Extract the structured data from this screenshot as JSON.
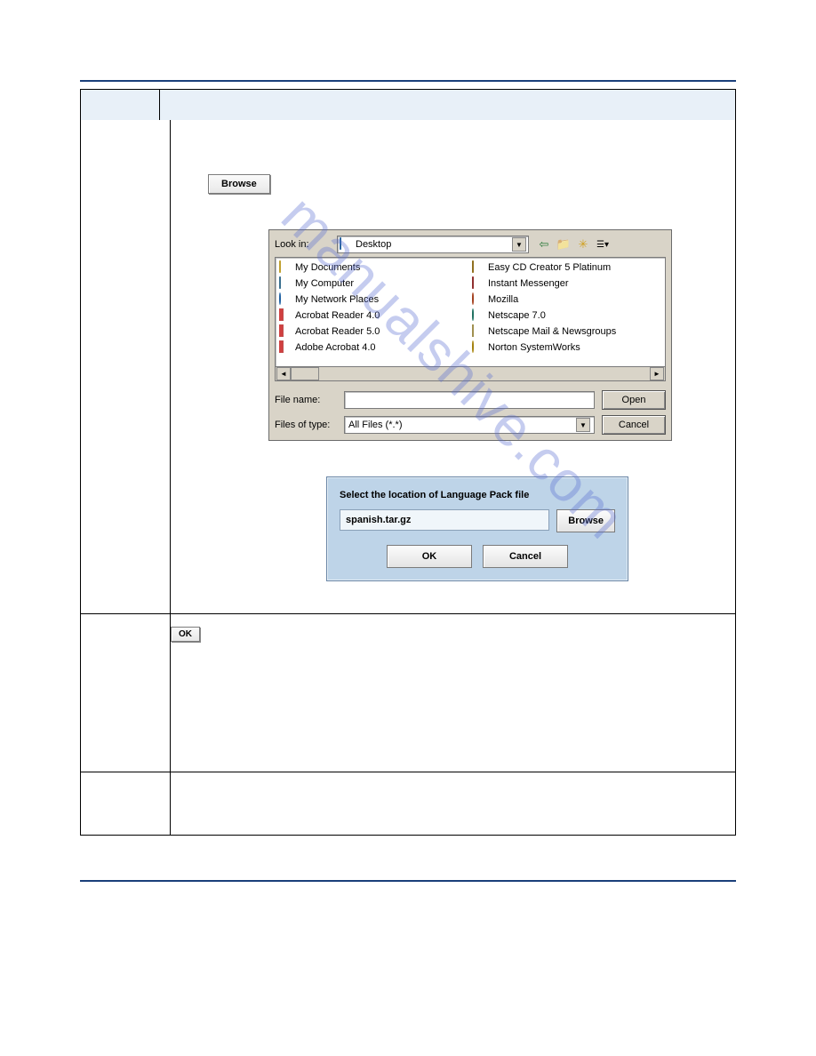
{
  "watermark": "manualshive.com",
  "buttons": {
    "browse_large": "Browse",
    "ok_small": "OK"
  },
  "file_dialog": {
    "look_in_label": "Look in:",
    "look_in_value": "Desktop",
    "toolbar": {
      "back": "⇦",
      "up": "📁",
      "new": "✳",
      "views": "☰▾"
    },
    "files_col1": [
      {
        "icon": "folder",
        "name": "My Documents"
      },
      {
        "icon": "monitor",
        "name": "My Computer"
      },
      {
        "icon": "globe",
        "name": "My Network Places"
      },
      {
        "icon": "pdf",
        "name": "Acrobat Reader 4.0"
      },
      {
        "icon": "pdf",
        "name": "Acrobat Reader 5.0"
      },
      {
        "icon": "pdf",
        "name": "Adobe Acrobat 4.0"
      }
    ],
    "files_col2": [
      {
        "icon": "app",
        "name": "Easy CD Creator 5 Platinum"
      },
      {
        "icon": "app2",
        "name": "Instant Messenger"
      },
      {
        "icon": "moz",
        "name": "Mozilla"
      },
      {
        "icon": "nc",
        "name": "Netscape 7.0"
      },
      {
        "icon": "mail",
        "name": "Netscape Mail & Newsgroups"
      },
      {
        "icon": "nsw",
        "name": "Norton SystemWorks"
      }
    ],
    "file_name_label": "File name:",
    "file_name_value": "",
    "files_of_type_label": "Files of type:",
    "files_of_type_value": "All Files (*.*)",
    "open_btn": "Open",
    "cancel_btn": "Cancel"
  },
  "lang_panel": {
    "title": "Select the location of Language Pack file",
    "input_value": "spanish.tar.gz",
    "browse": "Browse",
    "ok": "OK",
    "cancel": "Cancel"
  }
}
